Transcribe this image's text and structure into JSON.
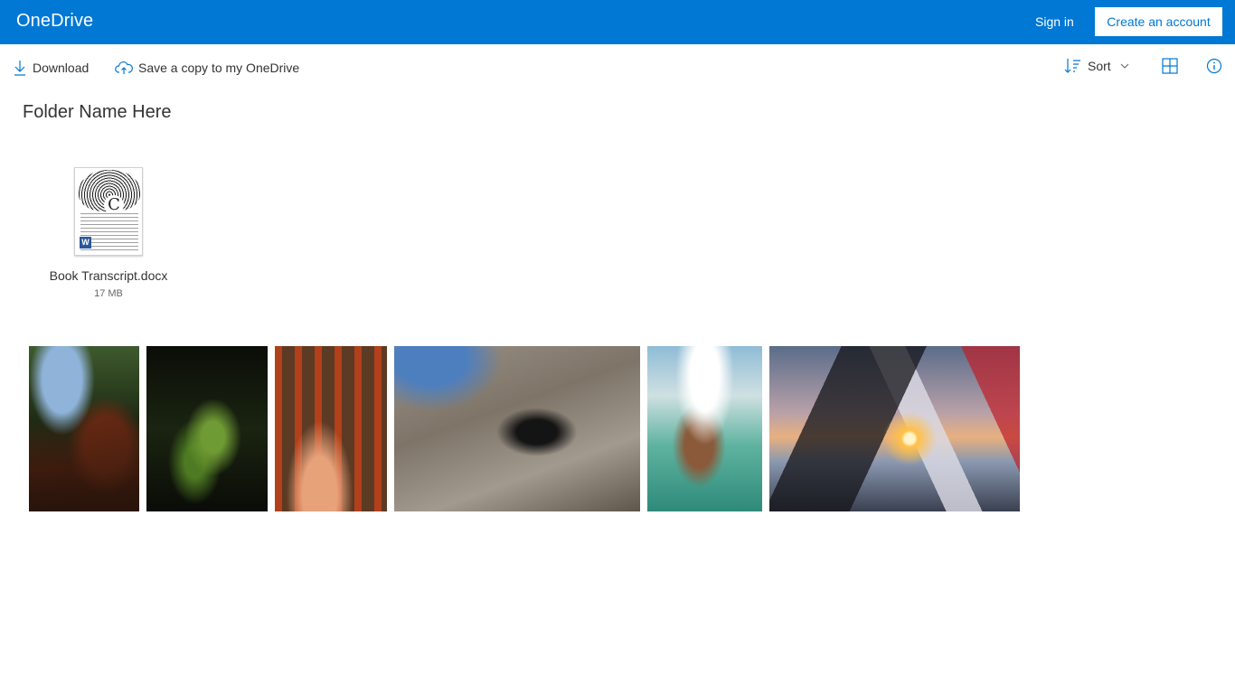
{
  "header": {
    "brand": "OneDrive",
    "sign_in": "Sign in",
    "create_account": "Create an account",
    "background_color": "#0078d4"
  },
  "commandbar": {
    "download": "Download",
    "save_copy": "Save a copy to my OneDrive",
    "sort": "Sort",
    "icons": [
      "download-icon",
      "cloud-upload-icon",
      "sort-icon",
      "chevron-down-icon",
      "grid-view-icon",
      "info-icon"
    ]
  },
  "folder": {
    "title": "Folder Name Here"
  },
  "files": [
    {
      "name": "Book Transcript.docx",
      "size": "17 MB",
      "type": "word-document"
    }
  ],
  "photos": [
    {
      "subject": "red-barked tree against sky"
    },
    {
      "subject": "green fern in dark forest"
    },
    {
      "subject": "orange-lit pine trunks"
    },
    {
      "subject": "black dog lying on rock"
    },
    {
      "subject": "painting of men in a boat"
    },
    {
      "subject": "sunset through tent opening"
    }
  ]
}
